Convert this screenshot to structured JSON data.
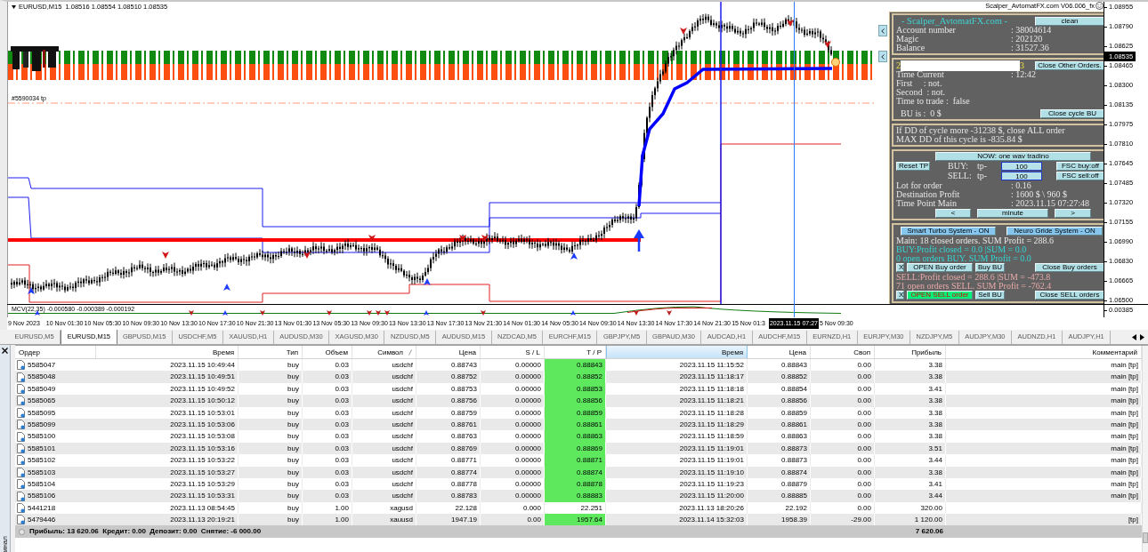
{
  "chart": {
    "symbol_line": "EURUSD,M15  1.08516 1.08554 1.08510 1.08535",
    "expert_label": "Scalper_AvtomatFX.com V06.006_fx",
    "order_label": "#5590034 tp",
    "price_axis": [
      "1.08955",
      "1.08790",
      "1.08625",
      "1.08465",
      "1.08300",
      "1.08135",
      "1.07975",
      "1.07810",
      "1.07645",
      "1.07485",
      "1.07320",
      "1.07155",
      "1.06990",
      "1.06830",
      "1.06665",
      "1.06500"
    ],
    "current_price": "1.08535",
    "indicator": {
      "label": "MCV(22,35) -0.000580 -0.000389 -0.000192",
      "axis_label": "0.00385"
    },
    "time_axis": [
      "9 Nov 2023",
      "10 Nov 01:30",
      "10 Nov 05:30",
      "10 Nov 09:30",
      "10 Nov 13:30",
      "10 Nov 17:30",
      "10 Nov 21:30",
      "13 Nov 01:30",
      "13 Nov 05:30",
      "13 Nov 09:30",
      "13 Nov 13:30",
      "13 Nov 17:30",
      "13 Nov 21:30",
      "14 Nov 01:30",
      "14 Nov 05:30",
      "14 Nov 09:30",
      "14 Nov 13:30",
      "14 Nov 17:30",
      "14 Nov 21:30",
      "15 Nov 01:3",
      "5 Nov 09:30"
    ],
    "cursor_time": "2023.11.15 07:27"
  },
  "panel": {
    "title": "- Scalper_AvtomatFX.com -",
    "clean_button": "clean",
    "account": [
      {
        "label": "Account number",
        "value": ": 38004614"
      },
      {
        "label": "Magic",
        "value": ": 202120"
      },
      {
        "label": "Balance",
        "value": ": 31527.36"
      }
    ],
    "redacted_line": {
      "start": "2",
      "end": "3"
    },
    "close_other_button": "Close Other Orders.",
    "time_current": {
      "label": "Time Current",
      "value": ": 12:42"
    },
    "status_lines": [
      "First     : not.",
      "Second  : not.",
      "Time to trade :  false"
    ],
    "bu_text": "BU is :  0 $",
    "close_cycle_button": "Close cycle BU",
    "dd_lines": [
      "If DD of cycle more -31238 $, close ALL order",
      "MAX DD of this cycle is -835.84 $"
    ],
    "mode_button": "NOW: one wav tradino",
    "reset_button": "Reset TP",
    "tp_rows": [
      {
        "side": "BUY:",
        "tp_label": "tp-",
        "value": "100",
        "fsc_button": "FSC buy:off"
      },
      {
        "side": "SELL:",
        "tp_label": "tp-",
        "value": "100",
        "fsc_button": "FSC sell:off"
      }
    ],
    "details": [
      {
        "label": "Lot for order",
        "value": ": 0.16"
      },
      {
        "label": "Destination Profit",
        "value": ": 1600 $ \\ 960 $"
      },
      {
        "label": "Time Point Main",
        "value": ": 2023.11.15 07:27:48"
      }
    ],
    "nav_buttons": [
      "<",
      "minute",
      ">"
    ],
    "systems": [
      {
        "label": "Smart Turbo System - ON",
        "on": true
      },
      {
        "label": "Neuro Gride System - ON",
        "on": true
      }
    ],
    "main_line": {
      "text": "Main: 18 closed orders. SUM Profit = 288.6",
      "color": "#e8e8e8"
    },
    "sides": [
      {
        "lines": [
          {
            "text": "BUY:Profit closed = 0.0 |SUM = 0.0",
            "color": "#33d6d6"
          },
          {
            "text": "0 open orders BUY. SUM Profit = 0.0",
            "color": "#33d6d6"
          }
        ],
        "buttons": [
          {
            "label": "X",
            "active": false
          },
          {
            "label": "OPEN Buy order",
            "active": false
          },
          {
            "label": "Buy BU",
            "active": false
          },
          {
            "label": "Close Buy orders",
            "active": false
          }
        ]
      },
      {
        "lines": [
          {
            "text": "SELL:Profit closed = 288.6 |SUM = -473.8",
            "color": "#e8a8a8"
          },
          {
            "text": "71 open orders SELL. SUM Profit = -762.4",
            "color": "#e8a8a8"
          }
        ],
        "buttons": [
          {
            "label": "X",
            "active": false
          },
          {
            "label": "OPEN SELL order",
            "active": true
          },
          {
            "label": "Sell BU",
            "active": false
          },
          {
            "label": "Close SELL orders",
            "active": false
          }
        ]
      }
    ]
  },
  "tabs": [
    {
      "label": "EURUSD,M5",
      "selected": false
    },
    {
      "label": "EURUSD,M15",
      "selected": true
    },
    {
      "label": "GBPUSD,M15",
      "selected": false
    },
    {
      "label": "USDCHF,M5",
      "selected": false
    },
    {
      "label": "XAUUSD,H1",
      "selected": false
    },
    {
      "label": "AUDUSD,M30",
      "selected": false
    },
    {
      "label": "XAGUSD,M30",
      "selected": false
    },
    {
      "label": "NZDUSD,M5",
      "selected": false
    },
    {
      "label": "AUDUSD,M15",
      "selected": false
    },
    {
      "label": "NZDCAD,M5",
      "selected": false
    },
    {
      "label": "EURCHF,M15",
      "selected": false
    },
    {
      "label": "GBPJPY,M5",
      "selected": false
    },
    {
      "label": "GBPAUD,M30",
      "selected": false
    },
    {
      "label": "AUDCAD,H1",
      "selected": false
    },
    {
      "label": "AUDCHF,M15",
      "selected": false
    },
    {
      "label": "EURNZD,H1",
      "selected": false
    },
    {
      "label": "EURJPY,M30",
      "selected": false
    },
    {
      "label": "NZDJPY,M5",
      "selected": false
    },
    {
      "label": "AUDJPY,M30",
      "selected": false
    },
    {
      "label": "AUDNZD,H1",
      "selected": false
    },
    {
      "label": "AUDJPY,H1",
      "selected": false
    }
  ],
  "terminal": {
    "title": "инал",
    "columns": [
      {
        "label": "Ордер",
        "selected": false,
        "sorted": false
      },
      {
        "label": "Время",
        "selected": false,
        "sorted": false
      },
      {
        "label": "Тип",
        "selected": false,
        "sorted": false
      },
      {
        "label": "Объем",
        "selected": false,
        "sorted": false
      },
      {
        "label": "Символ",
        "selected": false,
        "sorted": true
      },
      {
        "label": "Цена",
        "selected": false,
        "sorted": false
      },
      {
        "label": "S / L",
        "selected": false,
        "sorted": false
      },
      {
        "label": "T / P",
        "selected": false,
        "sorted": false
      },
      {
        "label": "Время",
        "selected": true,
        "sorted": false
      },
      {
        "label": "Цена",
        "selected": false,
        "sorted": false
      },
      {
        "label": "Своп",
        "selected": false,
        "sorted": false
      },
      {
        "label": "Прибыль",
        "selected": false,
        "sorted": false
      },
      {
        "label": "Комментарий",
        "selected": false,
        "sorted": false
      }
    ],
    "rows": [
      {
        "order": "5585047",
        "open_time": "2023.11.15 10:49:44",
        "type": "buy",
        "volume": "0.03",
        "symbol": "usdchf",
        "open_price": "0.88743",
        "sl": "0.00000",
        "tp": "0.88843",
        "tp_reached": true,
        "close_time": "2023.11.15 11:15:52",
        "close_price": "0.88843",
        "swap": "0.00",
        "profit": "3.38",
        "comment": "main [tp]"
      },
      {
        "order": "5585048",
        "open_time": "2023.11.15 10:49:51",
        "type": "buy",
        "volume": "0.03",
        "symbol": "usdchf",
        "open_price": "0.88752",
        "sl": "0.00000",
        "tp": "0.88852",
        "tp_reached": true,
        "close_time": "2023.11.15 11:18:17",
        "close_price": "0.88852",
        "swap": "0.00",
        "profit": "3.38",
        "comment": "main [tp]"
      },
      {
        "order": "5585049",
        "open_time": "2023.11.15 10:49:52",
        "type": "buy",
        "volume": "0.03",
        "symbol": "usdchf",
        "open_price": "0.88753",
        "sl": "0.00000",
        "tp": "0.88853",
        "tp_reached": true,
        "close_time": "2023.11.15 11:18:18",
        "close_price": "0.88854",
        "swap": "0.00",
        "profit": "3.41",
        "comment": "main [tp]"
      },
      {
        "order": "5585065",
        "open_time": "2023.11.15 10:50:12",
        "type": "buy",
        "volume": "0.03",
        "symbol": "usdchf",
        "open_price": "0.88756",
        "sl": "0.00000",
        "tp": "0.88856",
        "tp_reached": true,
        "close_time": "2023.11.15 11:18:21",
        "close_price": "0.88856",
        "swap": "0.00",
        "profit": "3.38",
        "comment": "main [tp]"
      },
      {
        "order": "5585095",
        "open_time": "2023.11.15 10:53:01",
        "type": "buy",
        "volume": "0.03",
        "symbol": "usdchf",
        "open_price": "0.88759",
        "sl": "0.00000",
        "tp": "0.88859",
        "tp_reached": true,
        "close_time": "2023.11.15 11:18:28",
        "close_price": "0.88859",
        "swap": "0.00",
        "profit": "3.38",
        "comment": "main [tp]"
      },
      {
        "order": "5585099",
        "open_time": "2023.11.15 10:53:06",
        "type": "buy",
        "volume": "0.03",
        "symbol": "usdchf",
        "open_price": "0.88761",
        "sl": "0.00000",
        "tp": "0.88861",
        "tp_reached": true,
        "close_time": "2023.11.15 11:18:29",
        "close_price": "0.88861",
        "swap": "0.00",
        "profit": "3.38",
        "comment": "main [tp]"
      },
      {
        "order": "5585100",
        "open_time": "2023.11.15 10:53:08",
        "type": "buy",
        "volume": "0.03",
        "symbol": "usdchf",
        "open_price": "0.88763",
        "sl": "0.00000",
        "tp": "0.88863",
        "tp_reached": true,
        "close_time": "2023.11.15 11:18:59",
        "close_price": "0.88863",
        "swap": "0.00",
        "profit": "3.38",
        "comment": "main [tp]"
      },
      {
        "order": "5585101",
        "open_time": "2023.11.15 10:53:16",
        "type": "buy",
        "volume": "0.03",
        "symbol": "usdchf",
        "open_price": "0.88769",
        "sl": "0.00000",
        "tp": "0.88869",
        "tp_reached": true,
        "close_time": "2023.11.15 11:19:01",
        "close_price": "0.88873",
        "swap": "0.00",
        "profit": "3.51",
        "comment": "main [tp]"
      },
      {
        "order": "5585102",
        "open_time": "2023.11.15 10:53:22",
        "type": "buy",
        "volume": "0.03",
        "symbol": "usdchf",
        "open_price": "0.88771",
        "sl": "0.00000",
        "tp": "0.88871",
        "tp_reached": true,
        "close_time": "2023.11.15 11:19:01",
        "close_price": "0.88873",
        "swap": "0.00",
        "profit": "3.44",
        "comment": "main [tp]"
      },
      {
        "order": "5585103",
        "open_time": "2023.11.15 10:53:27",
        "type": "buy",
        "volume": "0.03",
        "symbol": "usdchf",
        "open_price": "0.88774",
        "sl": "0.00000",
        "tp": "0.88874",
        "tp_reached": true,
        "close_time": "2023.11.15 11:19:10",
        "close_price": "0.88874",
        "swap": "0.00",
        "profit": "3.38",
        "comment": "main [tp]"
      },
      {
        "order": "5585104",
        "open_time": "2023.11.15 10:53:29",
        "type": "buy",
        "volume": "0.03",
        "symbol": "usdchf",
        "open_price": "0.88778",
        "sl": "0.00000",
        "tp": "0.88878",
        "tp_reached": true,
        "close_time": "2023.11.15 11:19:23",
        "close_price": "0.88879",
        "swap": "0.00",
        "profit": "3.41",
        "comment": "main [tp]"
      },
      {
        "order": "5585106",
        "open_time": "2023.11.15 10:53:31",
        "type": "buy",
        "volume": "0.03",
        "symbol": "usdchf",
        "open_price": "0.88783",
        "sl": "0.00000",
        "tp": "0.88883",
        "tp_reached": true,
        "close_time": "2023.11.15 11:20:00",
        "close_price": "0.88885",
        "swap": "0.00",
        "profit": "3.44",
        "comment": "main [tp]"
      },
      {
        "order": "5441218",
        "open_time": "2023.11.13 08:54:45",
        "type": "buy",
        "volume": "1.00",
        "symbol": "xagusd",
        "open_price": "22.128",
        "sl": "0.000",
        "tp": "22.251",
        "tp_reached": false,
        "close_time": "2023.11.13 18:20:26",
        "close_price": "22.192",
        "swap": "0.00",
        "profit": "320.00"
      },
      {
        "order": "5479446",
        "open_time": "2023.11.13 20:19:21",
        "type": "buy",
        "volume": "1.00",
        "symbol": "xauusd",
        "open_price": "1947.19",
        "sl": "0.00",
        "tp": "1957.64",
        "tp_reached": true,
        "close_time": "2023.11.14 15:32:03",
        "close_price": "1958.39",
        "swap": "-29.00",
        "profit": "1 120.00",
        "comment": "[tp]"
      }
    ],
    "summary": {
      "text": "Прибыль: 13 620.06  Кредит: 0.00  Депозит: 0.00  Снятие: -6 000.00",
      "total_profit": "7 620.06"
    }
  }
}
